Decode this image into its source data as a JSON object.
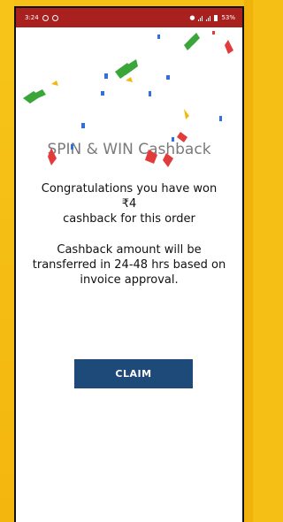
{
  "status_bar": {
    "time": "3:24",
    "battery_percent": "53%",
    "background_color": "#a9211f"
  },
  "page": {
    "title": "SPIN & WIN Cashback",
    "message_line1": "Congratulations you have won",
    "amount": "₹4",
    "message_line3": "cashback for this order",
    "note_line1": "Cashback amount will be",
    "note_line2": "transferred in 24-48 hrs based on",
    "note_line3": "invoice approval."
  },
  "claim": {
    "label": "CLAIM",
    "color": "#1d4a78"
  },
  "colors": {
    "frame": "#f6bf16",
    "confetti": [
      "#3aa63a",
      "#e33b3b",
      "#2f6fe0",
      "#f2b90f"
    ]
  }
}
